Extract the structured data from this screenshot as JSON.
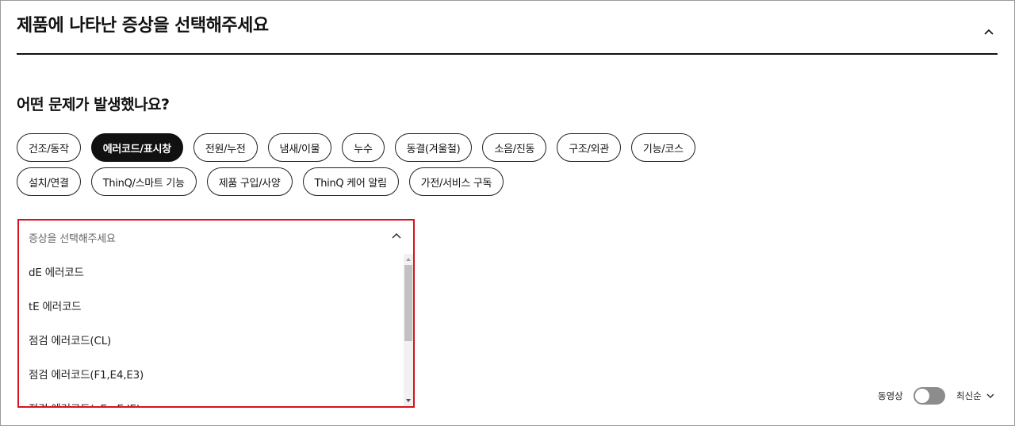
{
  "header": {
    "title": "제품에 나타난 증상을 선택해주세요",
    "collapse_icon": "chevron-up-icon"
  },
  "question": "어떤 문제가 발생했나요?",
  "categories": [
    {
      "label": "건조/동작",
      "selected": false
    },
    {
      "label": "에러코드/표시창",
      "selected": true
    },
    {
      "label": "전원/누전",
      "selected": false
    },
    {
      "label": "냄새/이물",
      "selected": false
    },
    {
      "label": "누수",
      "selected": false
    },
    {
      "label": "동결(겨울철)",
      "selected": false
    },
    {
      "label": "소음/진동",
      "selected": false
    },
    {
      "label": "구조/외관",
      "selected": false
    },
    {
      "label": "기능/코스",
      "selected": false
    },
    {
      "label": "설치/연결",
      "selected": false
    },
    {
      "label": "ThinQ/스마트 기능",
      "selected": false
    },
    {
      "label": "제품 구입/사양",
      "selected": false
    },
    {
      "label": "ThinQ 케어 알림",
      "selected": false
    },
    {
      "label": "가전/서비스 구독",
      "selected": false
    }
  ],
  "symptom_select": {
    "placeholder": "증상을 선택해주세요",
    "expanded": true,
    "options": [
      "dE 에러코드",
      "tE 에러코드",
      "점검 에러코드(CL)",
      "점검 에러코드(F1,E4,E3)",
      "점검 에러코드(oE,nE,IE)"
    ]
  },
  "list_controls": {
    "video_label": "동영상",
    "video_toggle_on": false,
    "sort_label": "최신순"
  },
  "colors": {
    "accent_red": "#d9121f",
    "chip_active_bg": "#111111",
    "toggle_off": "#8c8c8c"
  }
}
